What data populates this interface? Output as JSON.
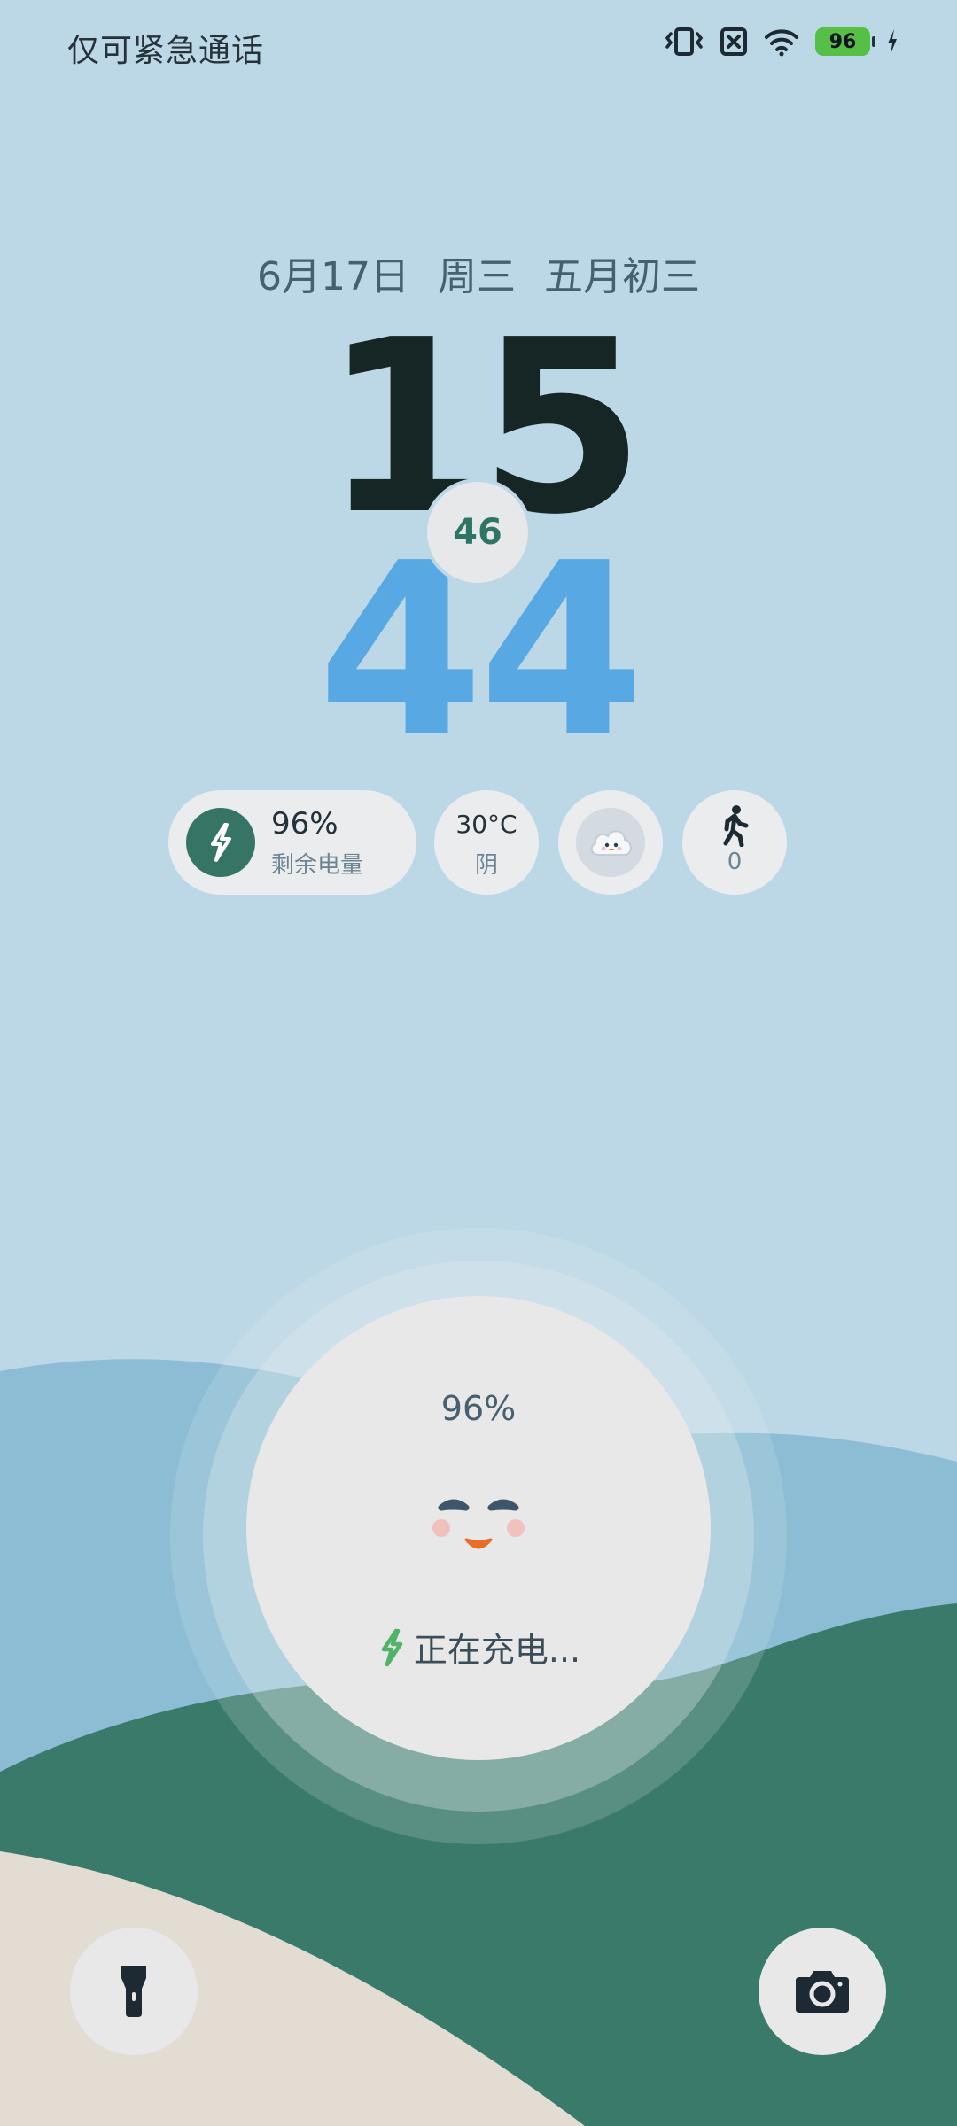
{
  "status_bar": {
    "carrier_text": "仅可紧急通话",
    "battery_level": "96",
    "icons": [
      "vibrate-icon",
      "no-sim-icon",
      "wifi-icon",
      "battery-icon",
      "charging-bolt-icon"
    ]
  },
  "lockscreen": {
    "date": "6月17日  周三  五月初三",
    "clock": {
      "hour": "15",
      "minute": "44",
      "second": "46"
    }
  },
  "widgets": {
    "battery": {
      "percent": "96%",
      "label": "剩余电量",
      "icon": "charging-bolt-icon"
    },
    "weather": {
      "temperature": "30°C",
      "condition": "阴"
    },
    "weather_icon": "cloud-face-icon",
    "steps": {
      "count": "0",
      "icon": "walking-person-icon"
    }
  },
  "charging": {
    "percent": "96%",
    "status": "正在充电...",
    "icon": "smiley-face-icon"
  },
  "shortcuts": {
    "left": "flashlight-icon",
    "right": "camera-icon"
  },
  "colors": {
    "sky": "#bcd8e7",
    "hour_digits": "#162624",
    "minute_digits": "#58a8e3",
    "accent_green": "#367565",
    "hill_blue": "#8cbdd5",
    "hill_green": "#3a7a6b",
    "sand": "#e2dcd3"
  }
}
